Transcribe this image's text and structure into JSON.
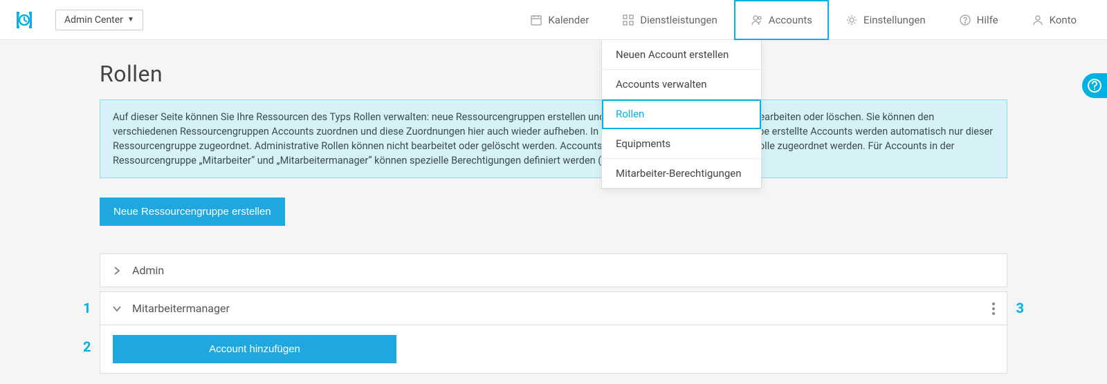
{
  "brand_select_label": "Admin Center",
  "nav": {
    "kalender": "Kalender",
    "dienstleistungen": "Dienstleistungen",
    "accounts": "Accounts",
    "einstellungen": "Einstellungen",
    "hilfe": "Hilfe",
    "konto": "Konto"
  },
  "accounts_menu": {
    "new_account": "Neuen Account erstellen",
    "manage_accounts": "Accounts verwalten",
    "roles": "Rollen",
    "equipments": "Equipments",
    "employee_permissions": "Mitarbeiter-Berechtigungen"
  },
  "page": {
    "title": "Rollen",
    "info_text": "Auf dieser Seite können Sie Ihre Ressourcen des Typs Rollen verwalten: neue Ressourcengruppen erstellen und bestehende Ressourcengruppen bearbeiten oder löschen. Sie können den verschiedenen Ressourcengruppen Accounts zuordnen und diese Zuordnungen hier auch wieder aufheben. In einer bestehenden Ressourcengruppe erstellte Accounts werden automatisch nur dieser Ressourcengruppe zugeordnet. Administrative Rollen können nicht bearbeitet oder gelöscht werden. Accounts können nur einer administrativen Rolle zugeordnet werden. Für Accounts in der Ressourcengruppe „Mitarbeiter“ und „Mitarbeitermanager“ können spezielle Berechtigungen definiert werden (z. B. Termine verwalten).",
    "create_group_button": "Neue Ressourcengruppe erstellen"
  },
  "groups": {
    "admin_label": "Admin",
    "manager_label": "Mitarbeitermanager",
    "add_account_button": "Account hinzufügen"
  },
  "annotations": {
    "n1": "1",
    "n2": "2",
    "n3": "3"
  }
}
